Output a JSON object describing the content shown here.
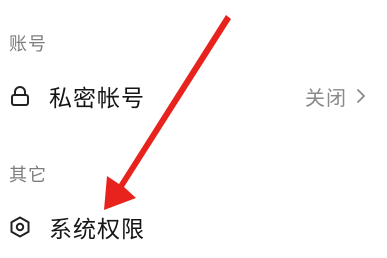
{
  "sections": {
    "account": {
      "label": "账号",
      "rows": [
        {
          "label": "私密帐号",
          "value": "关闭",
          "icon": "lock-icon"
        }
      ]
    },
    "other": {
      "label": "其它",
      "rows": [
        {
          "label": "系统权限",
          "icon": "hexagon-settings-icon"
        }
      ]
    }
  },
  "annotation": {
    "arrow_color": "#e8231e"
  }
}
